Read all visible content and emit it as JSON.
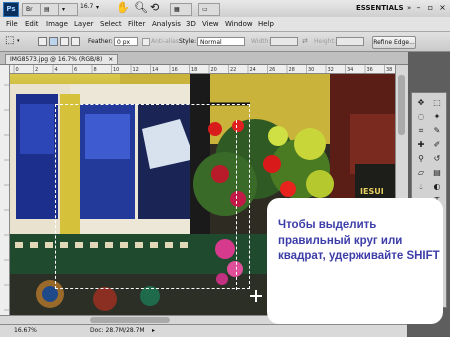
{
  "app": {
    "logo": "Ps",
    "zoom_value": "16.7",
    "workspace": "ESSENTIALS",
    "icons": [
      "hand-icon",
      "zoom-icon",
      "grid-icon",
      "screen-mode-icon",
      "arrange-icon",
      "minimize-icon",
      "restore-icon",
      "close-icon"
    ]
  },
  "menu": {
    "items": [
      "File",
      "Edit",
      "Image",
      "Layer",
      "Select",
      "Filter",
      "Analysis",
      "3D",
      "View",
      "Window",
      "Help"
    ]
  },
  "options_bar": {
    "feather_label": "Feather:",
    "feather_value": "0 px",
    "anti_alias_label": "Anti-alias",
    "style_label": "Style:",
    "style_value": "Normal",
    "width_label": "Width:",
    "height_label": "Height:",
    "refine_edge_label": "Refine Edge..."
  },
  "document": {
    "tab_title": "IMG8573.jpg @ 16.7% (RGB/8)",
    "ruler_ticks": [
      "0",
      "2",
      "4",
      "6",
      "8",
      "10",
      "12",
      "14",
      "16",
      "18",
      "20",
      "22",
      "24",
      "26",
      "28",
      "30",
      "32",
      "34",
      "36",
      "38"
    ]
  },
  "status": {
    "zoom": "16.67%",
    "doc_size": "Doc: 28.7M/28.7M"
  },
  "callout": {
    "text": "Чтобы выделить правильный круг или квадрат, удерживайте SHIFT"
  },
  "photo": {
    "sign_text": "IESUI"
  }
}
